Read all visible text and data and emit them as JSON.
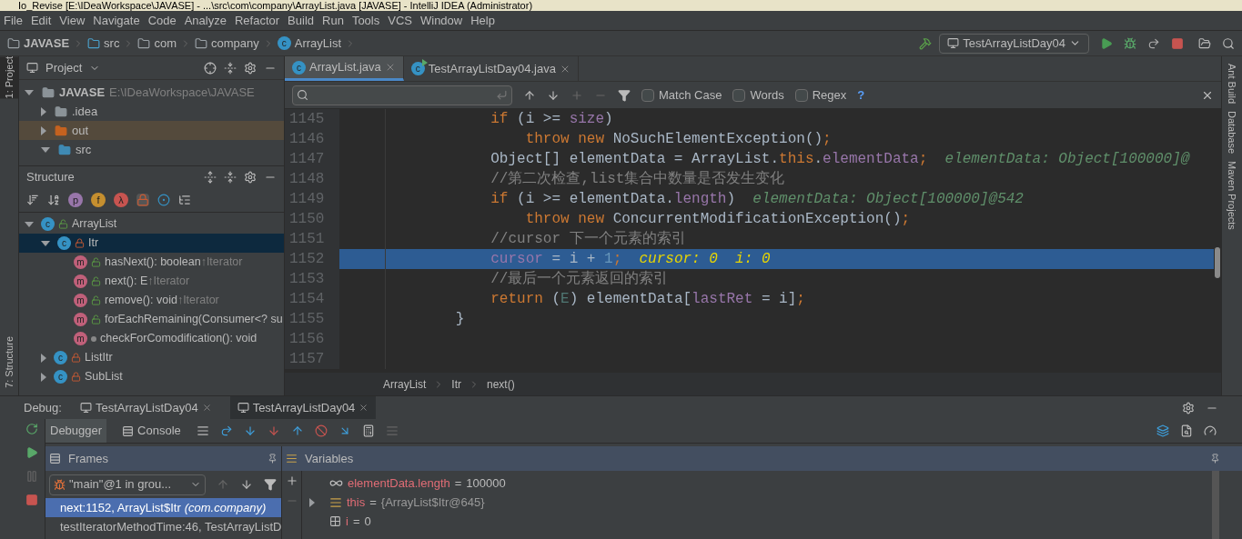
{
  "window": {
    "title": "Io_Revise [E:\\IDeaWorkspace\\JAVASE] - ...\\src\\com\\company\\ArrayList.java [JAVASE] - IntelliJ IDEA (Administrator)"
  },
  "menu": [
    "File",
    "Edit",
    "View",
    "Navigate",
    "Code",
    "Analyze",
    "Refactor",
    "Build",
    "Run",
    "Tools",
    "VCS",
    "Window",
    "Help"
  ],
  "breadcrumbs": [
    {
      "label": "JAVASE",
      "kind": "module"
    },
    {
      "label": "src",
      "kind": "source"
    },
    {
      "label": "com",
      "kind": "package"
    },
    {
      "label": "company",
      "kind": "package"
    },
    {
      "label": "ArrayList",
      "kind": "class",
      "badge": "c"
    }
  ],
  "run_config": {
    "label": "TestArrayListDay04"
  },
  "left_strip": [
    {
      "label": "1: Project",
      "selected": true
    },
    {
      "label": "7: Structure",
      "selected": false
    }
  ],
  "right_strip": [
    "Ant Build",
    "Database",
    "Maven Projects"
  ],
  "project": {
    "title": "Project",
    "items": [
      {
        "label": "JAVASE",
        "path": "E:\\IDeaWorkspace\\JAVASE",
        "kind": "module",
        "expanded": true,
        "selected": false
      },
      {
        "label": ".idea",
        "kind": "folder",
        "expanded": false,
        "selected": false
      },
      {
        "label": "out",
        "kind": "excluded",
        "expanded": false,
        "selected": true
      },
      {
        "label": "src",
        "kind": "source",
        "expanded": true,
        "selected": false
      }
    ]
  },
  "structure": {
    "title": "Structure",
    "toolbar": [
      {
        "glyph": "p",
        "color": "#9876aa",
        "selected": false
      },
      {
        "glyph": "f",
        "color": "#c58f2f",
        "selected": false
      },
      {
        "glyph": "λ",
        "color": "#c75450",
        "selected": false
      }
    ],
    "items": [
      {
        "badge": "c",
        "label": "ArrayList",
        "kind": "public",
        "expanded": true,
        "selected": false,
        "children": [
          {
            "badge": "c",
            "label": "Itr",
            "kind": "private",
            "expanded": true,
            "selected": true,
            "children": [
              {
                "badge": "m",
                "label": "hasNext(): boolean",
                "super": "↑Iterator",
                "kind": "public"
              },
              {
                "badge": "m",
                "label": "next(): E",
                "super": "↑Iterator",
                "kind": "public"
              },
              {
                "badge": "m",
                "label": "remove(): void",
                "super": "↑Iterator",
                "kind": "public"
              },
              {
                "badge": "m",
                "label": "forEachRemaining(Consumer<? su",
                "kind": "public"
              },
              {
                "badge": "m",
                "label": "checkForComodification(): void",
                "kind": "package"
              }
            ]
          },
          {
            "badge": "c",
            "label": "ListItr",
            "kind": "private",
            "expanded": false,
            "selected": false
          },
          {
            "badge": "c",
            "label": "SubList",
            "kind": "private",
            "expanded": false,
            "selected": false
          }
        ]
      }
    ]
  },
  "editor": {
    "tabs": [
      {
        "label": "ArrayList.java",
        "badge": "c",
        "kind": "class",
        "selected": true
      },
      {
        "label": "TestArrayListDay04.java",
        "badge": "c",
        "kind": "runnable",
        "selected": false
      }
    ],
    "find": {
      "options": [
        {
          "label": "Match Case",
          "checked": false
        },
        {
          "label": "Words",
          "checked": false
        },
        {
          "label": "Regex",
          "checked": false
        }
      ],
      "help": "?"
    },
    "lines": [
      {
        "number": "1145",
        "selected": false,
        "tokens": [
          {
            "text": "            if",
            "kind": "keyword"
          },
          {
            "text": " (i >= ",
            "kind": "plain"
          },
          {
            "text": "size",
            "kind": "field"
          },
          {
            "text": ")",
            "kind": "plain"
          }
        ]
      },
      {
        "number": "1146",
        "selected": false,
        "tokens": [
          {
            "text": "                throw new ",
            "kind": "keyword"
          },
          {
            "text": "NoSuchElementException()",
            "kind": "plain"
          },
          {
            "text": ";",
            "kind": "keyword"
          }
        ]
      },
      {
        "number": "1147",
        "selected": false,
        "tokens": [
          {
            "text": "            Object[] elementData = ArrayList.",
            "kind": "plain"
          },
          {
            "text": "this",
            "kind": "keyword"
          },
          {
            "text": ".",
            "kind": "plain"
          },
          {
            "text": "elementData",
            "kind": "field"
          },
          {
            "text": ";",
            "kind": "keyword"
          },
          {
            "text": "  elementData: Object[100000]@",
            "kind": "inline"
          }
        ]
      },
      {
        "number": "1148",
        "selected": false,
        "tokens": [
          {
            "text": "            //第二次检查,list集合中数量是否发生变化",
            "kind": "comment"
          }
        ]
      },
      {
        "number": "1149",
        "selected": false,
        "tokens": [
          {
            "text": "            if",
            "kind": "keyword"
          },
          {
            "text": " (i >= elementData.",
            "kind": "plain"
          },
          {
            "text": "length",
            "kind": "field"
          },
          {
            "text": ")",
            "kind": "plain"
          },
          {
            "text": "  elementData: Object[100000]@542",
            "kind": "inline"
          }
        ]
      },
      {
        "number": "1150",
        "selected": false,
        "tokens": [
          {
            "text": "                throw new ",
            "kind": "keyword"
          },
          {
            "text": "ConcurrentModificationException()",
            "kind": "plain"
          },
          {
            "text": ";",
            "kind": "keyword"
          }
        ]
      },
      {
        "number": "1151",
        "selected": false,
        "tokens": [
          {
            "text": "            //cursor 下一个元素的索引",
            "kind": "comment"
          }
        ]
      },
      {
        "number": "1152",
        "selected": true,
        "tokens": [
          {
            "text": "            cursor",
            "kind": "field"
          },
          {
            "text": " = i + ",
            "kind": "plain"
          },
          {
            "text": "1",
            "kind": "number"
          },
          {
            "text": ";",
            "kind": "keyword"
          },
          {
            "text": "  cursor: 0  i: 0",
            "kind": "inline"
          }
        ]
      },
      {
        "number": "1153",
        "selected": false,
        "tokens": [
          {
            "text": "            //最后一个元素返回的索引",
            "kind": "comment"
          }
        ]
      },
      {
        "number": "1154",
        "selected": false,
        "tokens": [
          {
            "text": "            return ",
            "kind": "keyword"
          },
          {
            "text": "(",
            "kind": "plain"
          },
          {
            "text": "E",
            "kind": "typeparam"
          },
          {
            "text": ") elementData[",
            "kind": "plain"
          },
          {
            "text": "lastRet",
            "kind": "field"
          },
          {
            "text": " = i]",
            "kind": "plain"
          },
          {
            "text": ";",
            "kind": "keyword"
          }
        ]
      },
      {
        "number": "1155",
        "selected": false,
        "tokens": [
          {
            "text": "        }",
            "kind": "plain"
          }
        ]
      },
      {
        "number": "1156",
        "selected": false
      },
      {
        "number": "1157",
        "selected": false
      }
    ],
    "path": [
      "ArrayList",
      "Itr",
      "next()"
    ]
  },
  "debug": {
    "label": "Debug:",
    "sessions": [
      {
        "label": "TestArrayListDay04",
        "selected": false
      },
      {
        "label": "TestArrayListDay04",
        "selected": true
      }
    ],
    "tabs": [
      {
        "label": "Debugger",
        "selected": true
      },
      {
        "label": "Console",
        "selected": false
      }
    ],
    "frames": {
      "title": "Frames",
      "thread": "\"main\"@1 in grou...",
      "items": [
        {
          "label": "next:1152, ArrayList$Itr",
          "package": "(com.company)",
          "selected": true
        },
        {
          "label": "testIteratorMethodTime:46, TestArrayListD",
          "selected": false
        }
      ]
    },
    "variables": {
      "title": "Variables",
      "items": [
        {
          "kind": "watch",
          "name": "elementData.length",
          "op": "=",
          "value": "100000"
        },
        {
          "kind": "object",
          "name": "this",
          "op": "=",
          "value": "{ArrayList$Itr@645}"
        },
        {
          "kind": "primitive",
          "name": "i",
          "op": "=",
          "value": "0"
        }
      ]
    }
  }
}
